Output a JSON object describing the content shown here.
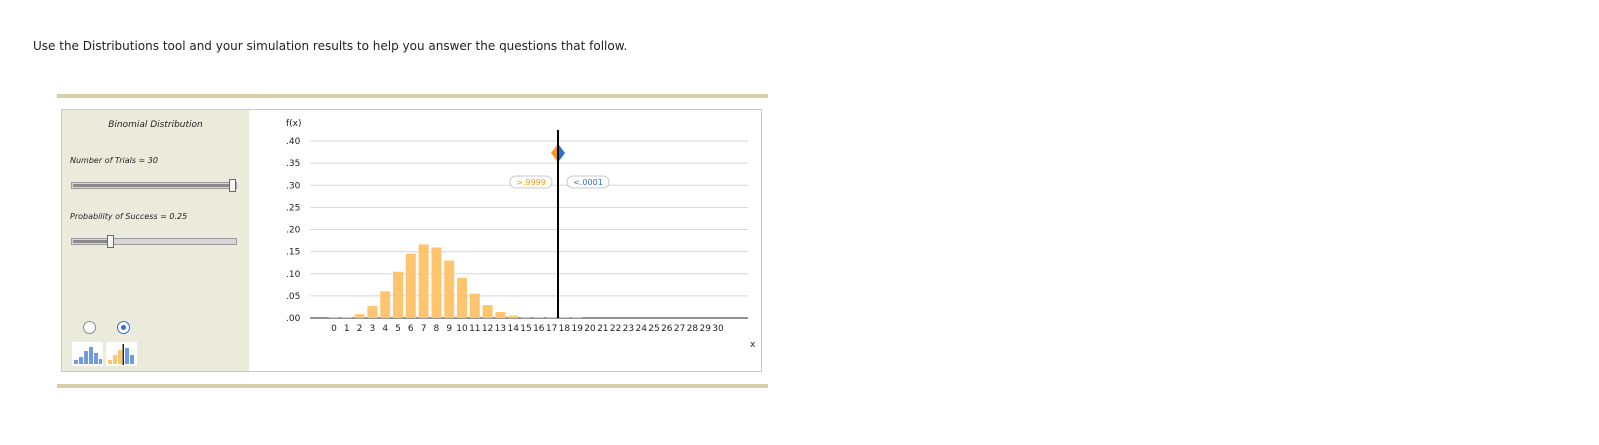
{
  "instruction": "Use the Distributions tool and your simulation results to help you answer the questions that follow.",
  "panel": {
    "title": "Binomial Distribution",
    "trials_label": "Number of Trials = 30",
    "probability_label": "Probability of Success = 0.25",
    "trials_slider_fraction": 1.0,
    "probability_slider_fraction": 0.22,
    "radio_selected": 1
  },
  "chart_data": {
    "type": "bar",
    "title": "",
    "ylabel": "f(x)",
    "xlabel": "x",
    "ylim": [
      0,
      0.4
    ],
    "yticks": [
      ".40",
      ".35",
      ".30",
      ".25",
      ".20",
      ".15",
      ".10",
      ".05",
      ".00"
    ],
    "categories": [
      "0",
      "1",
      "2",
      "3",
      "4",
      "5",
      "6",
      "7",
      "8",
      "9",
      "10",
      "11",
      "12",
      "13",
      "14",
      "15",
      "16",
      "17",
      "18",
      "19",
      "20",
      "21",
      "22",
      "23",
      "24",
      "25",
      "26",
      "27",
      "28",
      "29",
      "30"
    ],
    "values": [
      0.0002,
      0.0018,
      0.0086,
      0.0269,
      0.0604,
      0.1047,
      0.1455,
      0.1662,
      0.1593,
      0.1298,
      0.0909,
      0.0551,
      0.0291,
      0.0134,
      0.0054,
      0.0019,
      0.0006,
      0.0002,
      4e-05,
      1e-05,
      0,
      0,
      0,
      0,
      0,
      0,
      0,
      0,
      0,
      0,
      0
    ],
    "marker_x": 17.5,
    "left_area_label": ">.9999",
    "right_area_label": "<.0001",
    "bar_color": "#ffc46e",
    "left_color": "#f39c1a",
    "right_color": "#2f6fd0",
    "grid": true
  }
}
